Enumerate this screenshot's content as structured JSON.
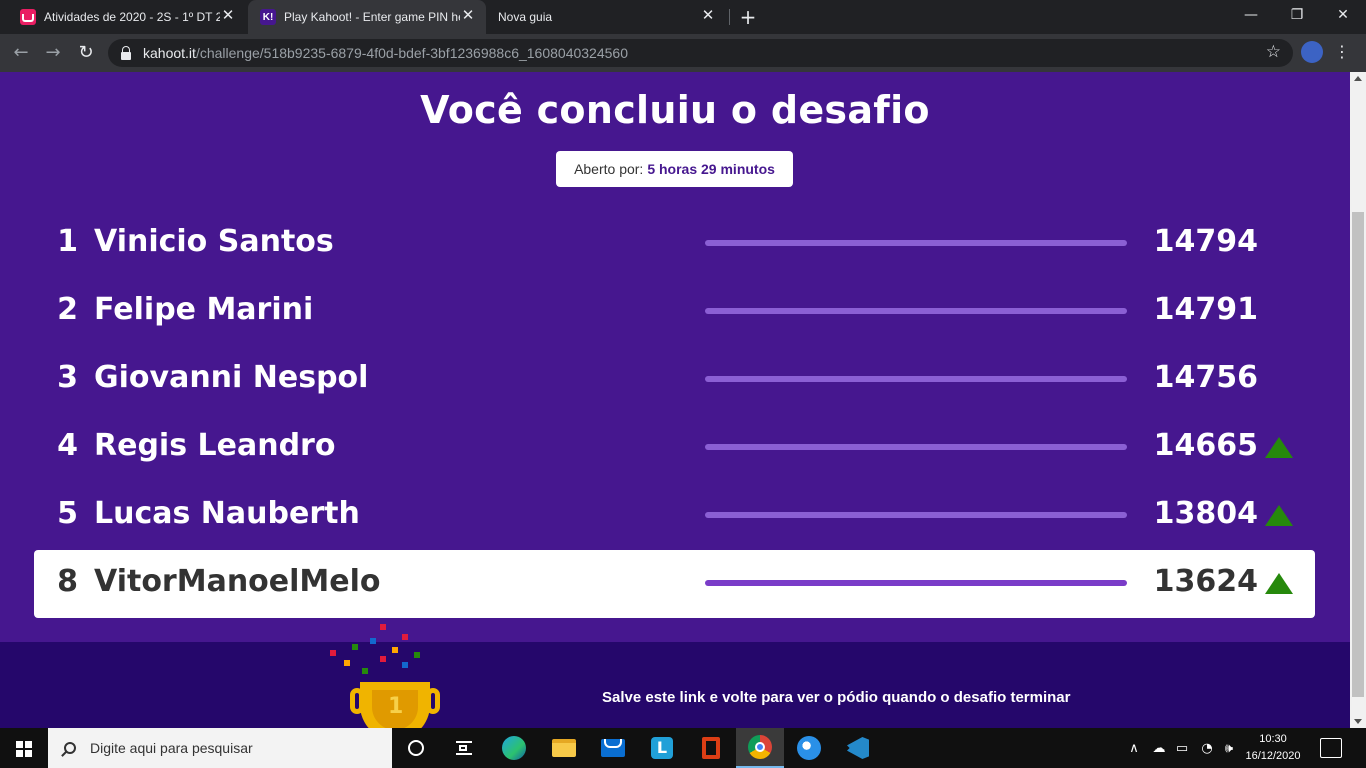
{
  "browser": {
    "tabs": [
      {
        "title": "Atividades de 2020 - 2S - 1º DT 2",
        "active": false
      },
      {
        "title": "Play Kahoot! - Enter game PIN he",
        "active": true
      },
      {
        "title": "Nova guia",
        "active": false
      }
    ],
    "url_host": "kahoot.it",
    "url_path": "/challenge/518b9235-6879-4f0d-bdef-3bf1236988c6_1608040324560"
  },
  "page": {
    "title": "Você concluiu o desafio",
    "opened_label": "Aberto por:",
    "opened_duration": "5 horas 29 minutos",
    "leaderboard": [
      {
        "rank": "1",
        "name": "Vinicio Santos",
        "score": "14794",
        "trend_up": false,
        "is_player": false
      },
      {
        "rank": "2",
        "name": "Felipe Marini",
        "score": "14791",
        "trend_up": false,
        "is_player": false
      },
      {
        "rank": "3",
        "name": "Giovanni Nespol",
        "score": "14756",
        "trend_up": false,
        "is_player": false
      },
      {
        "rank": "4",
        "name": "Regis Leandro",
        "score": "14665",
        "trend_up": true,
        "is_player": false
      },
      {
        "rank": "5",
        "name": "Lucas Nauberth",
        "score": "13804",
        "trend_up": true,
        "is_player": false
      },
      {
        "rank": "8",
        "name": "VitorManoelMelo",
        "score": "13624",
        "trend_up": true,
        "is_player": true
      }
    ],
    "save_link_text": "Salve este link e volte para ver o pódio quando o desafio terminar",
    "trophy_number": "1",
    "colors": {
      "background": "#46178f",
      "bottom_band": "#25076b",
      "trend_up": "#26890c"
    }
  },
  "taskbar": {
    "search_placeholder": "Digite aqui para pesquisar",
    "time": "10:30",
    "date": "16/12/2020",
    "apps": [
      "task-view-icon",
      "edge-icon",
      "file-explorer-icon",
      "mail-icon",
      "l-app-icon",
      "office-icon",
      "chrome-icon",
      "firefox-icon",
      "vscode-icon"
    ]
  }
}
